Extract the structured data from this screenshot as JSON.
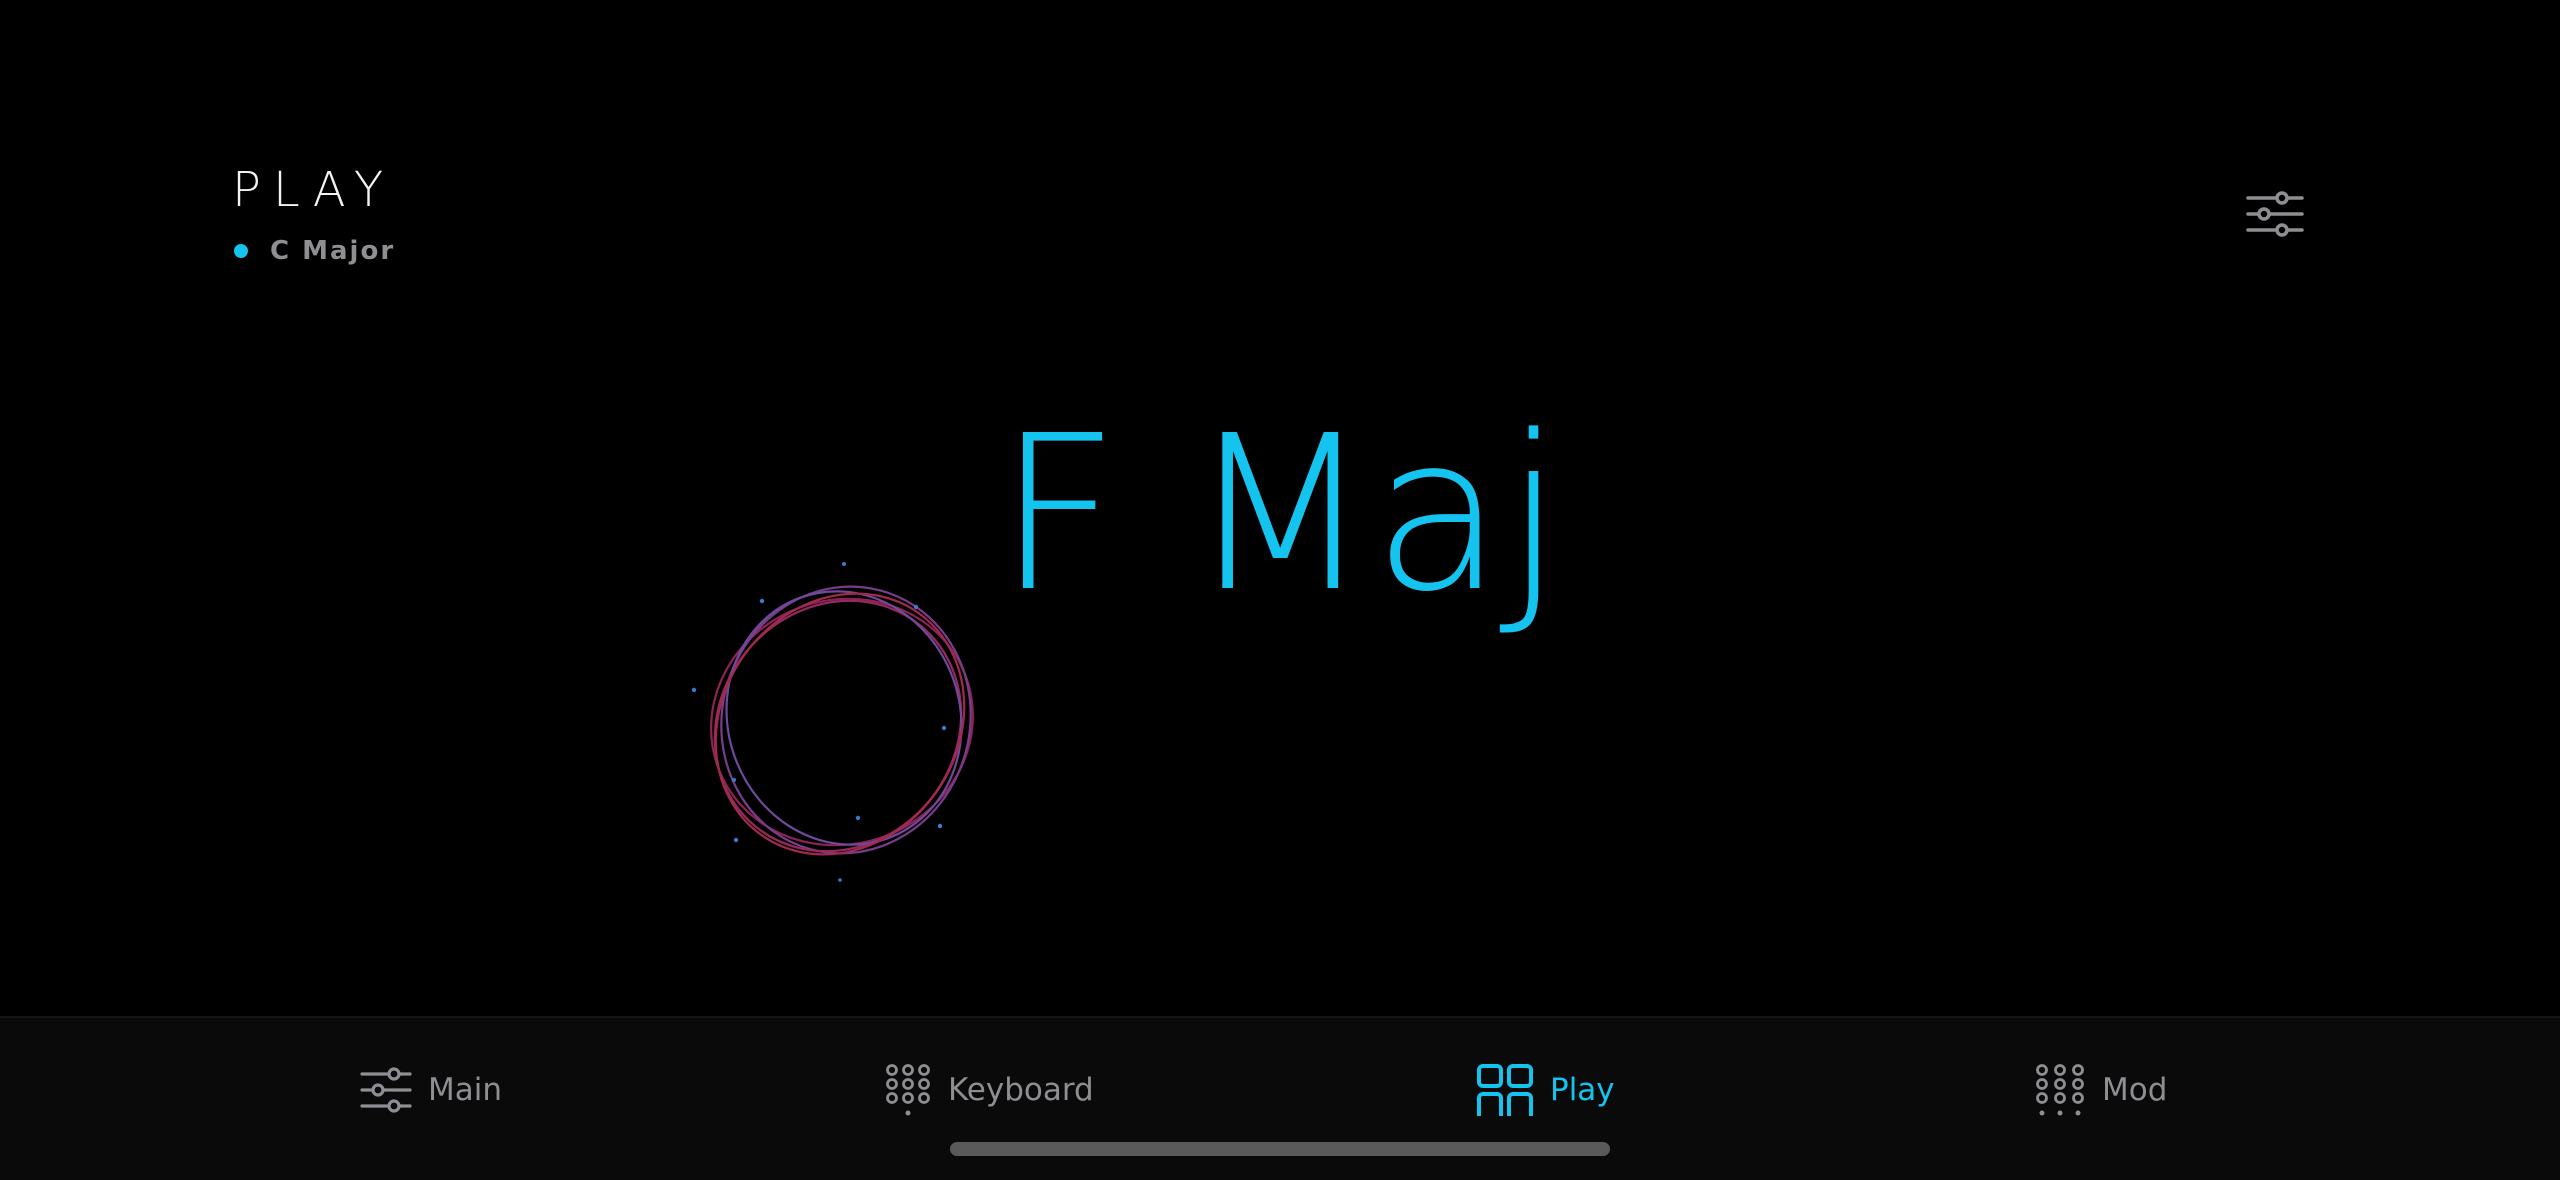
{
  "header": {
    "title": "PLAY",
    "scale_label": "C Major"
  },
  "chord": {
    "name": "F Maj"
  },
  "icons": {
    "settings": "sliders-icon",
    "main": "sliders-icon",
    "keyboard": "keypad-grid-icon",
    "play": "pads-grid-icon",
    "mod": "dots-grid-icon"
  },
  "tabs": [
    {
      "label": "Main",
      "active": false
    },
    {
      "label": "Keyboard",
      "active": false
    },
    {
      "label": "Play",
      "active": true
    },
    {
      "label": "Mod",
      "active": false
    }
  ],
  "colors": {
    "accent": "#15c3ef",
    "inactive": "#8e8e93",
    "orb_primary": "#8a2a6a",
    "orb_secondary": "#6a3a8a"
  }
}
